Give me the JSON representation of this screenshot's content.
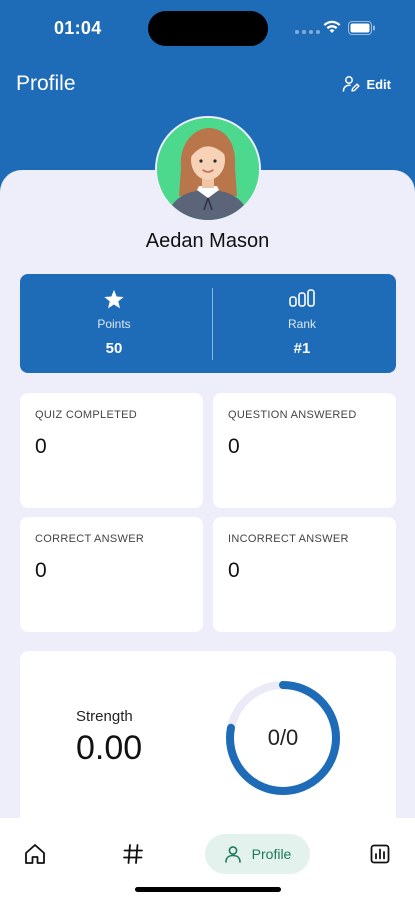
{
  "status_bar": {
    "time": "01:04"
  },
  "header": {
    "title": "Profile",
    "edit_label": "Edit"
  },
  "user": {
    "name": "Aedan Mason",
    "avatar_icon": "avatar-illustration"
  },
  "stats": {
    "points": {
      "icon": "star-icon",
      "label": "Points",
      "value": "50"
    },
    "rank": {
      "icon": "rank-bars-icon",
      "label": "Rank",
      "value": "#1"
    }
  },
  "metrics": [
    {
      "label": "QUIZ COMPLETED",
      "value": "0"
    },
    {
      "label": "QUESTION ANSWERED",
      "value": "0"
    },
    {
      "label": "CORRECT ANSWER",
      "value": "0"
    },
    {
      "label": "INCORRECT ANSWER",
      "value": "0"
    }
  ],
  "strength": {
    "label": "Strength",
    "value": "0.00",
    "ring_text": "0/0",
    "ring_fill_fraction": 0.78
  },
  "nav": {
    "items": [
      {
        "icon": "home-icon",
        "label": ""
      },
      {
        "icon": "hash-icon",
        "label": ""
      },
      {
        "icon": "user-icon",
        "label": "Profile"
      },
      {
        "icon": "leaderboard-icon",
        "label": ""
      }
    ],
    "active": "Profile"
  },
  "colors": {
    "primary": "#1e6bb8",
    "background": "#eeeefb",
    "avatar_bg": "#4cd98e",
    "nav_active_bg": "#e4f2ee",
    "nav_active_text": "#1b7a5a"
  }
}
